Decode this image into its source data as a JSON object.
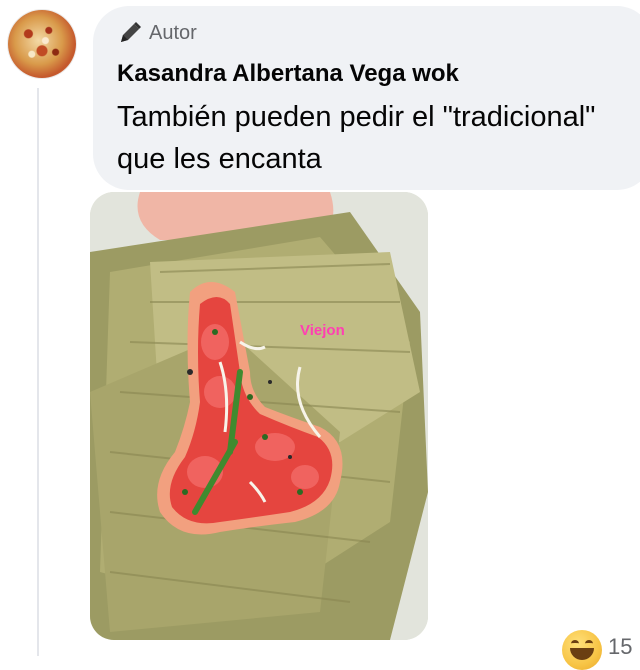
{
  "comment": {
    "author_badge": "Autor",
    "badge_icon": "pen-icon",
    "author_name": "Kasandra Albertana Vega wok",
    "text": "También pueden pedir el \"tradicional\" que les encanta",
    "avatar_icon": "avatar-food-image",
    "attachment": {
      "watermark": "Viejon",
      "watermark_color": "#ff3fb2"
    },
    "reactions": {
      "icon": "haha-emoji-icon",
      "count": "15"
    }
  },
  "colors": {
    "bubble_bg": "#f0f2f5",
    "name_text": "#050505",
    "secondary_text": "#65676b"
  }
}
